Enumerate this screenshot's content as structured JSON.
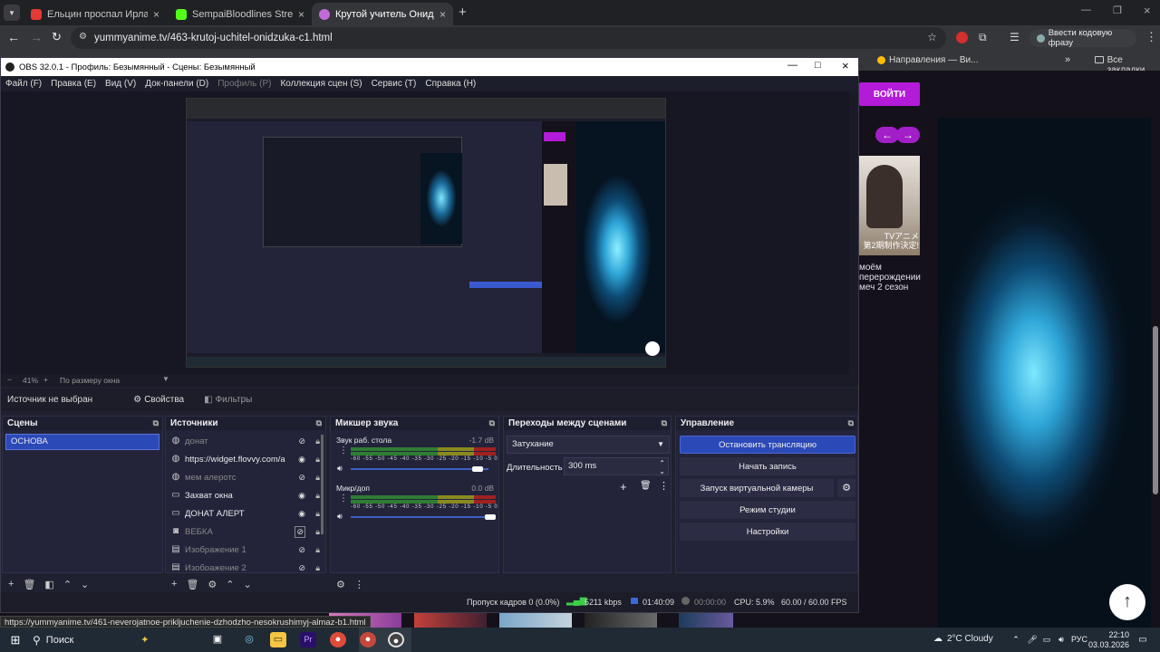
{
  "browser": {
    "tabs": [
      {
        "title": "Ельцин проспал Ирландию (Т",
        "favicon_color": "#e53935",
        "active": false
      },
      {
        "title": "SempaiBloodlines Stream - Wat",
        "favicon_color": "#53fc18",
        "active": false
      },
      {
        "title": "Крутой учитель Онидзука смо",
        "favicon_color": "#c26bd8",
        "active": true
      }
    ],
    "new_tab": "+",
    "url": "yummyanime.tv/463-krutoj-uchitel-onidzuka-c1.html",
    "profile_label": "Ввести кодовую фразу",
    "bookmarks": {
      "directions": "Направления — Ви...",
      "more": "»",
      "all": "Все закладки"
    }
  },
  "site": {
    "login_button": "ВОЙТИ",
    "prev": "←",
    "next": "→",
    "caption": "моём\nперерождении\nмеч 2 сезон",
    "poster_text": "TVアニメ\n第2期制作決定!",
    "scroll_top": "↑",
    "status_url": "https://yummyanime.tv/461-neverojatnoe-prikljuchenie-dzhodzho-nesokrushimyj-almaz-b1.html"
  },
  "obs": {
    "title": "OBS 32.0.1 - Профиль: Безымянный - Сцены: Безымянный",
    "menu": [
      "Файл (F)",
      "Правка (E)",
      "Вид (V)",
      "Док-панели (D)",
      "Профиль (P)",
      "Коллекция сцен (S)",
      "Сервис (T)",
      "Справка (H)"
    ],
    "zoom_percent": "41%",
    "zoom_mode": "По размеру окна",
    "no_source": "Источник не выбран",
    "properties": "Свойства",
    "filters": "Фильтры",
    "scenes": {
      "title": "Сцены",
      "items": [
        "ОСНОВА"
      ]
    },
    "sources": {
      "title": "Источники",
      "items": [
        {
          "name": "донат",
          "icon": "globe-icon",
          "visible": false
        },
        {
          "name": "https://widget.flovvy.com/a",
          "icon": "globe-icon",
          "visible": true
        },
        {
          "name": "мем алеротс",
          "icon": "globe-icon",
          "visible": false
        },
        {
          "name": "Захват окна",
          "icon": "window-icon",
          "visible": true
        },
        {
          "name": "ДОНАТ АЛЕРТ",
          "icon": "window-icon",
          "visible": true
        },
        {
          "name": "ВЕБКА",
          "icon": "camera-icon",
          "visible": false
        },
        {
          "name": "Изображение 1",
          "icon": "image-icon",
          "visible": false
        },
        {
          "name": "Изображение 2",
          "icon": "image-icon",
          "visible": false
        }
      ]
    },
    "mixer": {
      "title": "Микшер звука",
      "channels": [
        {
          "name": "Звук раб. стола",
          "db": "-1.7 dB",
          "level": 0.93,
          "volume": 0.95
        },
        {
          "name": "Микр/доп",
          "db": "0.0 dB",
          "level": 0.98,
          "volume": 1.0
        }
      ],
      "scale": "-60 -55 -50 -45 -40 -35 -30 -25 -20 -15 -10 -5 0"
    },
    "transitions": {
      "title": "Переходы между сценами",
      "selected": "Затухание",
      "duration_label": "Длительность",
      "duration": "300 ms"
    },
    "controls": {
      "title": "Управление",
      "buttons": [
        "Остановить трансляцию",
        "Начать запись",
        "Запуск виртуальной камеры",
        "Режим студии",
        "Настройки"
      ]
    },
    "status": {
      "dropped": "Пропуск кадров 0 (0.0%)",
      "bitrate": "5211 kbps",
      "stream_time": "01:40:09",
      "rec_time": "00:00:00",
      "cpu": "CPU: 5.9%",
      "fps": "60.00 / 60.00 FPS"
    }
  },
  "taskbar": {
    "search": "Поиск",
    "weather": "2°C  Cloudy",
    "lang": "РУС",
    "time": "22:10",
    "date": "03.03.2026"
  },
  "colors": {
    "accent": "#2c49b8",
    "purple": "#b31bd8",
    "obs_bg": "#202130"
  }
}
